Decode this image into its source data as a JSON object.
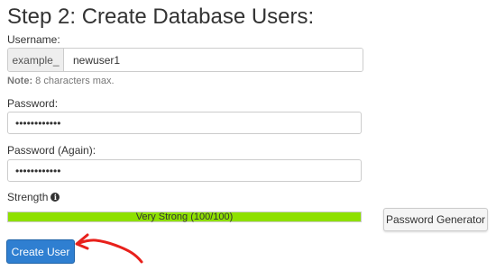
{
  "page": {
    "title": "Step 2: Create Database Users:"
  },
  "form": {
    "username": {
      "label": "Username:",
      "prefix": "example_",
      "value": "newuser1"
    },
    "note": {
      "bold": "Note:",
      "text": " 8 characters max."
    },
    "password": {
      "label": "Password:",
      "masked_value": "••••••••••••"
    },
    "password_again": {
      "label": "Password (Again):",
      "masked_value": "••••••••••••"
    },
    "strength": {
      "label": "Strength",
      "info_icon": "info-circle-icon",
      "meter_text": "Very Strong (100/100)",
      "meter_value": 1.0,
      "meter_color": "#8ee000"
    }
  },
  "buttons": {
    "password_generator": "Password Generator",
    "create_user": "Create User"
  },
  "annotation": {
    "arrow_color": "#e8201b"
  }
}
